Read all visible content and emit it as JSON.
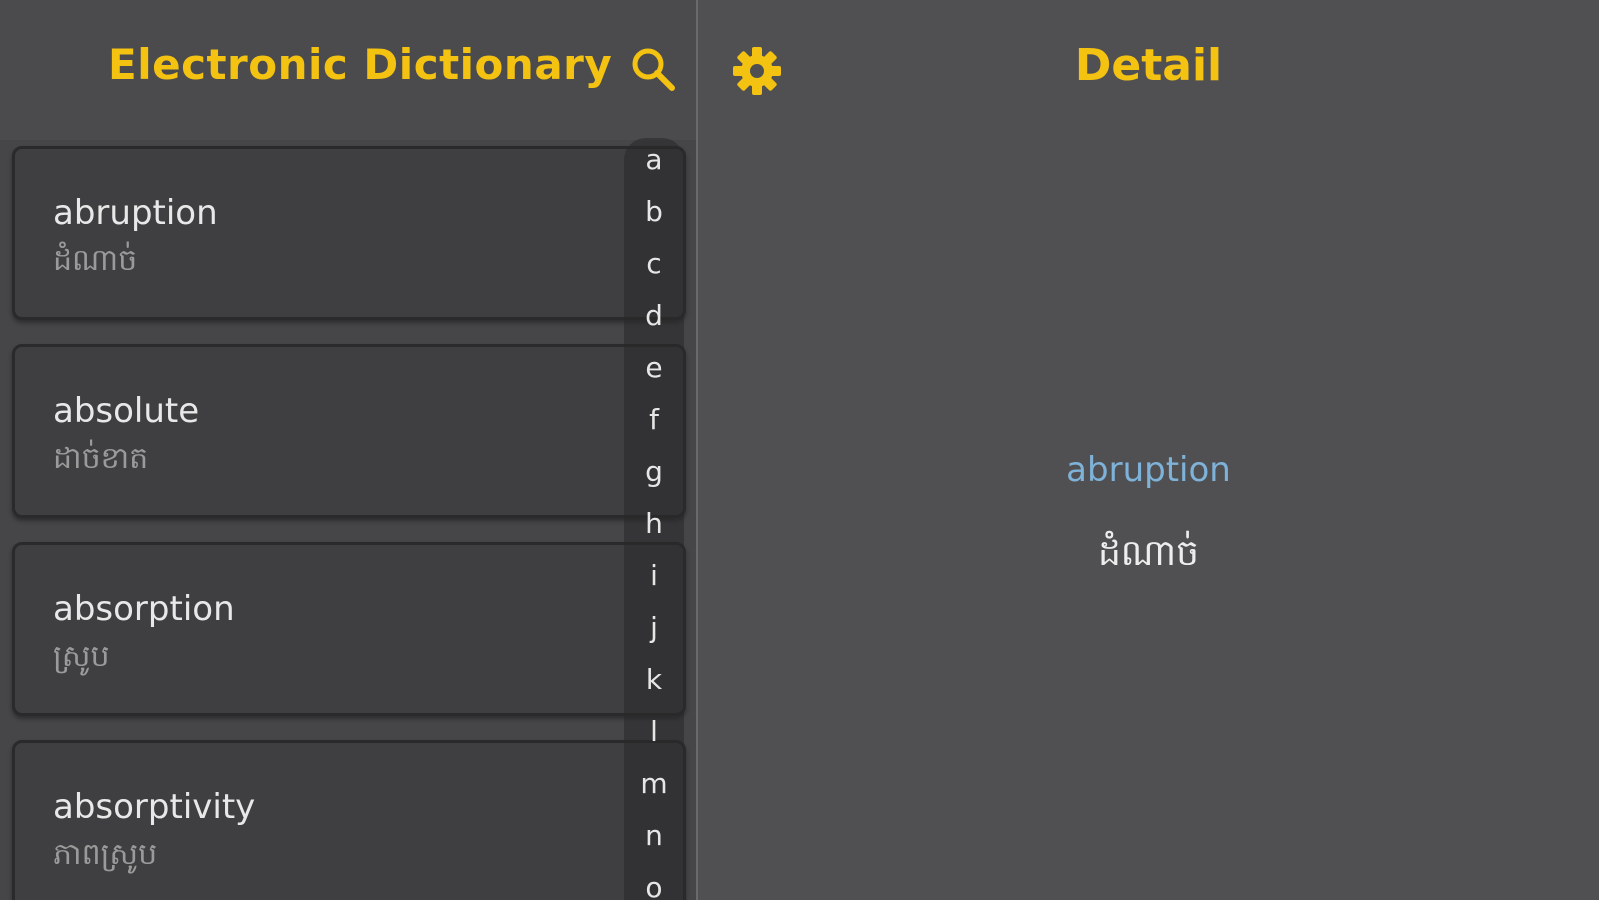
{
  "header": {
    "title": "Electronic Dictionary",
    "search_icon": "search-icon",
    "settings_icon": "gear-icon",
    "detail_title": "Detail"
  },
  "colors": {
    "accent": "#f4c211",
    "link": "#7fb2d8"
  },
  "words": [
    {
      "word": "abruption",
      "meaning": "ដំណាច់"
    },
    {
      "word": "absolute",
      "meaning": "ដាច់ខាត"
    },
    {
      "word": "absorption",
      "meaning": "ស្រូប"
    },
    {
      "word": "absorptivity",
      "meaning": "ភាពស្រូប"
    }
  ],
  "index_letters": [
    "a",
    "b",
    "c",
    "d",
    "e",
    "f",
    "g",
    "h",
    "i",
    "j",
    "k",
    "l",
    "m",
    "n",
    "o"
  ],
  "detail": {
    "word": "abruption",
    "meaning": "ដំណាច់"
  }
}
